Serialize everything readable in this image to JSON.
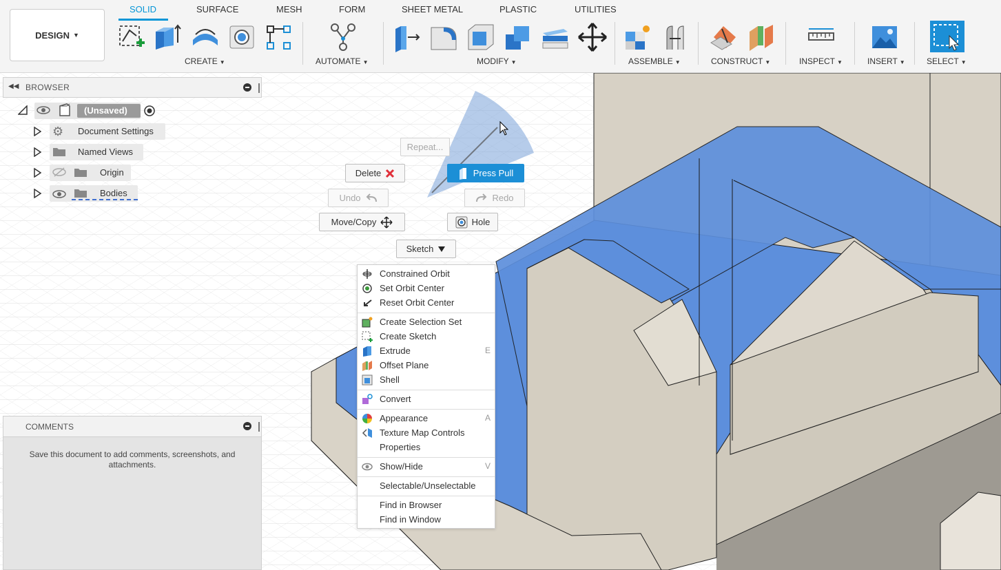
{
  "workspace": {
    "label": "DESIGN"
  },
  "tabs": [
    "SOLID",
    "SURFACE",
    "MESH",
    "FORM",
    "SHEET METAL",
    "PLASTIC",
    "UTILITIES"
  ],
  "active_tab": "SOLID",
  "groups": {
    "create": "CREATE",
    "automate": "AUTOMATE",
    "modify": "MODIFY",
    "assemble": "ASSEMBLE",
    "construct": "CONSTRUCT",
    "inspect": "INSPECT",
    "insert": "INSERT",
    "select": "SELECT"
  },
  "browser": {
    "title": "BROWSER",
    "root": "(Unsaved)",
    "items": [
      "Document Settings",
      "Named Views",
      "Origin",
      "Bodies"
    ]
  },
  "comments": {
    "title": "COMMENTS",
    "message": "Save this document to add comments, screenshots, and attachments."
  },
  "marking_menu": {
    "repeat": "Repeat...",
    "delete": "Delete",
    "press_pull": "Press Pull",
    "undo": "Undo",
    "redo": "Redo",
    "move_copy": "Move/Copy",
    "hole": "Hole",
    "sketch": "Sketch"
  },
  "context_menu": {
    "items": [
      {
        "label": "Constrained Orbit",
        "shortcut": ""
      },
      {
        "label": "Set Orbit Center",
        "shortcut": ""
      },
      {
        "label": "Reset Orbit Center",
        "shortcut": ""
      },
      {
        "label": "Create Selection Set",
        "shortcut": ""
      },
      {
        "label": "Create Sketch",
        "shortcut": ""
      },
      {
        "label": "Extrude",
        "shortcut": "E"
      },
      {
        "label": "Offset Plane",
        "shortcut": ""
      },
      {
        "label": "Shell",
        "shortcut": ""
      },
      {
        "label": "Convert",
        "shortcut": ""
      },
      {
        "label": "Appearance",
        "shortcut": "A"
      },
      {
        "label": "Texture Map Controls",
        "shortcut": ""
      },
      {
        "label": "Properties",
        "shortcut": ""
      },
      {
        "label": "Show/Hide",
        "shortcut": "V"
      },
      {
        "label": "Selectable/Unselectable",
        "shortcut": ""
      },
      {
        "label": "Find in Browser",
        "shortcut": ""
      },
      {
        "label": "Find in Window",
        "shortcut": ""
      }
    ]
  },
  "colors": {
    "accent": "#0696d7",
    "selection_face": "#5d8fdc",
    "model_face": "#d8d2c6",
    "press_pull_active": "#1c8fd6"
  }
}
